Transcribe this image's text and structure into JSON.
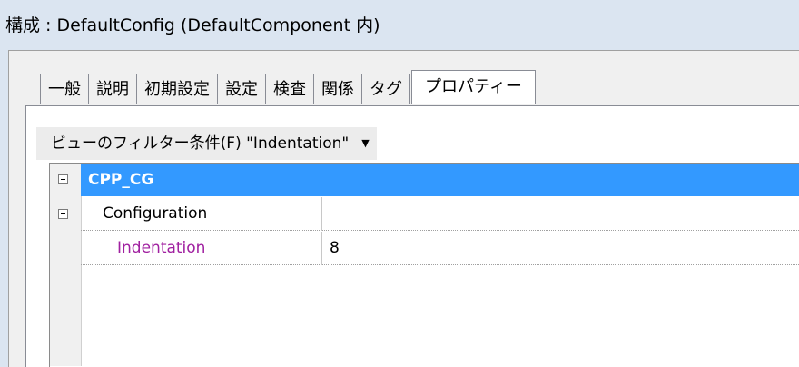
{
  "window": {
    "title": "構成 : DefaultConfig (DefaultComponent 内)"
  },
  "tabs": [
    {
      "label": "一般",
      "active": false
    },
    {
      "label": "説明",
      "active": false
    },
    {
      "label": "初期設定",
      "active": false
    },
    {
      "label": "設定",
      "active": false
    },
    {
      "label": "検査",
      "active": false
    },
    {
      "label": "関係",
      "active": false
    },
    {
      "label": "タグ",
      "active": false
    },
    {
      "label": "プロパティー",
      "active": true
    }
  ],
  "filter": {
    "label": "ビューのフィルター条件(F) \"Indentation\"",
    "arrow_icon": "dropdown-arrow-icon"
  },
  "grid": {
    "category": {
      "label": "CPP_CG",
      "expanded": true
    },
    "subcategory": {
      "label": "Configuration",
      "expanded": true
    },
    "property": {
      "name": "Indentation",
      "value": "8"
    }
  },
  "colors": {
    "selection": "#3399ff",
    "property_name": "#a020a0",
    "background": "#dbe5f1"
  }
}
